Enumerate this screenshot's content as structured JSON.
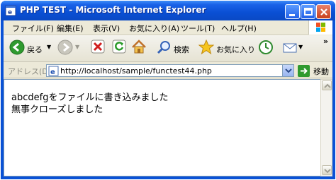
{
  "window": {
    "title": "PHP TEST - Microsoft Internet Explorer"
  },
  "menu": [
    "ファイル(F)",
    "編集(E)",
    "表示(V)",
    "お気に入り(A)",
    "ツール(T)",
    "ヘルプ(H)"
  ],
  "toolbar": {
    "back_label": "戻る",
    "search_label": "検索",
    "favorites_label": "お気に入り"
  },
  "address": {
    "label": "アドレス(D)",
    "url": "http://localhost/sample/functest44.php",
    "go_label": "移動"
  },
  "content": {
    "lines": [
      "abcdefgをファイルに書き込みました",
      "無事クローズしました"
    ]
  },
  "colors": {
    "titlebar": "#0a52d6",
    "chrome": "#ece9d8"
  }
}
